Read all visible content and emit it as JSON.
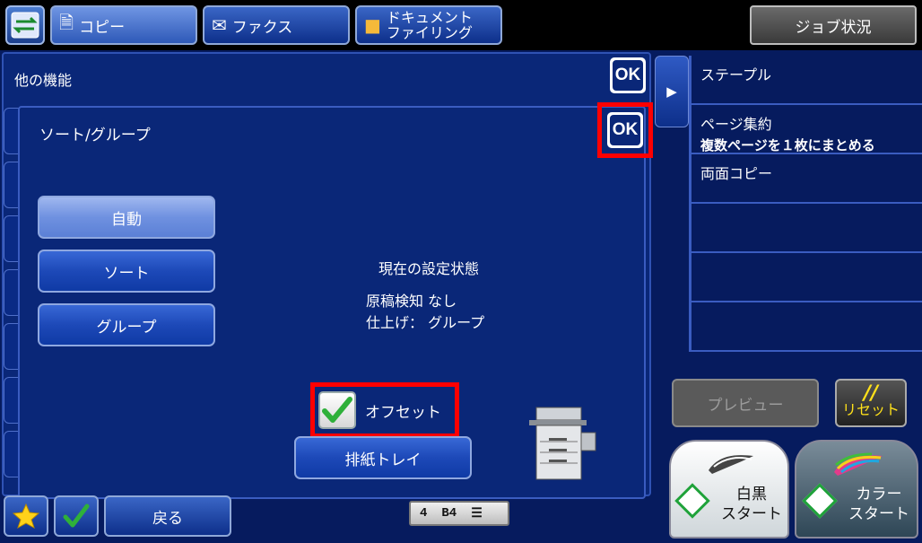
{
  "topbar": {
    "tabs": [
      {
        "label": "コピー"
      },
      {
        "label": "ファクス"
      },
      {
        "label_line1": "ドキュメント",
        "label_line2": "ファイリング"
      }
    ],
    "job_status": "ジョブ状況"
  },
  "outer": {
    "title": "他の機能",
    "ok": "OK"
  },
  "dialog": {
    "title": "ソート/グループ",
    "ok": "OK",
    "modes": [
      "自動",
      "ソート",
      "グループ"
    ],
    "selected_mode": "自動",
    "status_heading": "現在の設定状態",
    "status_lines": [
      "原稿検知 なし",
      "仕上げ： グループ"
    ],
    "offset_label": "オフセット",
    "offset_checked": true,
    "tray_button": "排紙トレイ"
  },
  "functions": [
    {
      "label": "ステープル",
      "sub": ""
    },
    {
      "label": "ページ集約",
      "sub": "複数ページを１枚にまとめる"
    },
    {
      "label": "両面コピー",
      "sub": ""
    },
    {
      "label": "",
      "sub": ""
    },
    {
      "label": "",
      "sub": ""
    },
    {
      "label": "",
      "sub": ""
    }
  ],
  "actions": {
    "preview": "プレビュー",
    "reset_symbol": "//",
    "reset": "リセット",
    "start_bw_line1": "白黒",
    "start_bw_line2": "スタート",
    "start_color_line1": "カラー",
    "start_color_line2": "スタート"
  },
  "bottom": {
    "back": "戻る",
    "paper_tray": "4",
    "paper_size": "B4"
  },
  "colors": {
    "highlight": "#ff0000",
    "panel": "#0a2778",
    "check_green": "#2fb03a"
  }
}
